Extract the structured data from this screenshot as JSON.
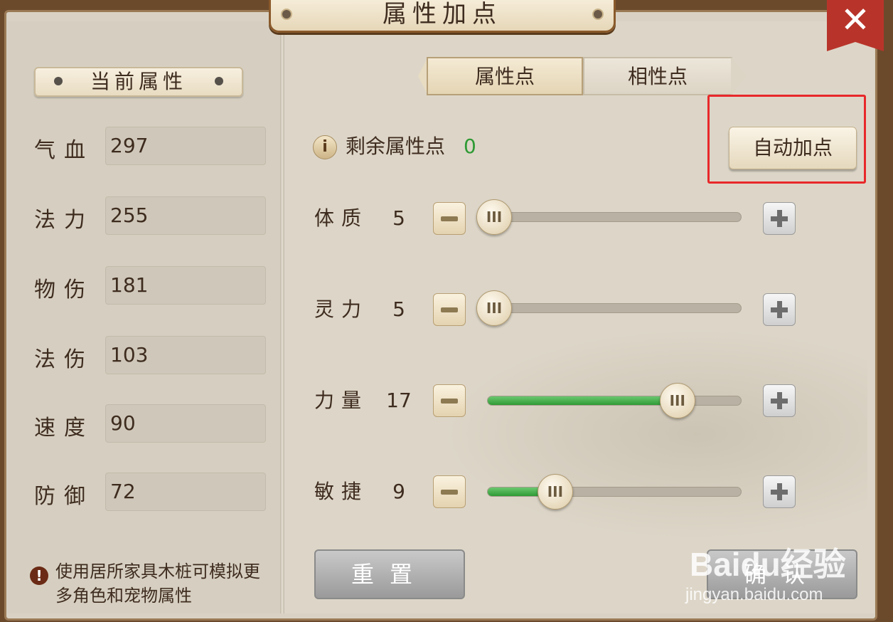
{
  "window": {
    "title": "属性加点",
    "close_icon": "close-icon"
  },
  "left": {
    "header": "当前属性",
    "stats": [
      {
        "label": "气血",
        "value": "297"
      },
      {
        "label": "法力",
        "value": "255"
      },
      {
        "label": "物伤",
        "value": "181"
      },
      {
        "label": "法伤",
        "value": "103"
      },
      {
        "label": "速度",
        "value": "90"
      },
      {
        "label": "防御",
        "value": "72"
      }
    ],
    "note_icon": "!",
    "note": "使用居所家具木桩可模拟更多角色和宠物属性"
  },
  "tabs": [
    {
      "label": "属性点",
      "active": true
    },
    {
      "label": "相性点",
      "active": false
    }
  ],
  "remaining": {
    "info_icon": "i",
    "label": "剩余属性点",
    "value": "0",
    "value_color": "#2f9a35"
  },
  "auto_button": "自动加点",
  "attributes": [
    {
      "label": "体质",
      "value": "5",
      "fill": 0.0
    },
    {
      "label": "灵力",
      "value": "5",
      "fill": 0.0
    },
    {
      "label": "力量",
      "value": "17",
      "fill": 0.72
    },
    {
      "label": "敏捷",
      "value": "9",
      "fill": 0.24
    }
  ],
  "slider_knob_glyph": "III",
  "reset_button": "重置",
  "confirm_button": "确认",
  "watermark": {
    "main": "Baidu经验",
    "sub": "jingyan.baidu.com"
  },
  "colors": {
    "accent_green": "#2f9a35",
    "highlight_red": "#e8282a",
    "close_red": "#b8342a"
  }
}
